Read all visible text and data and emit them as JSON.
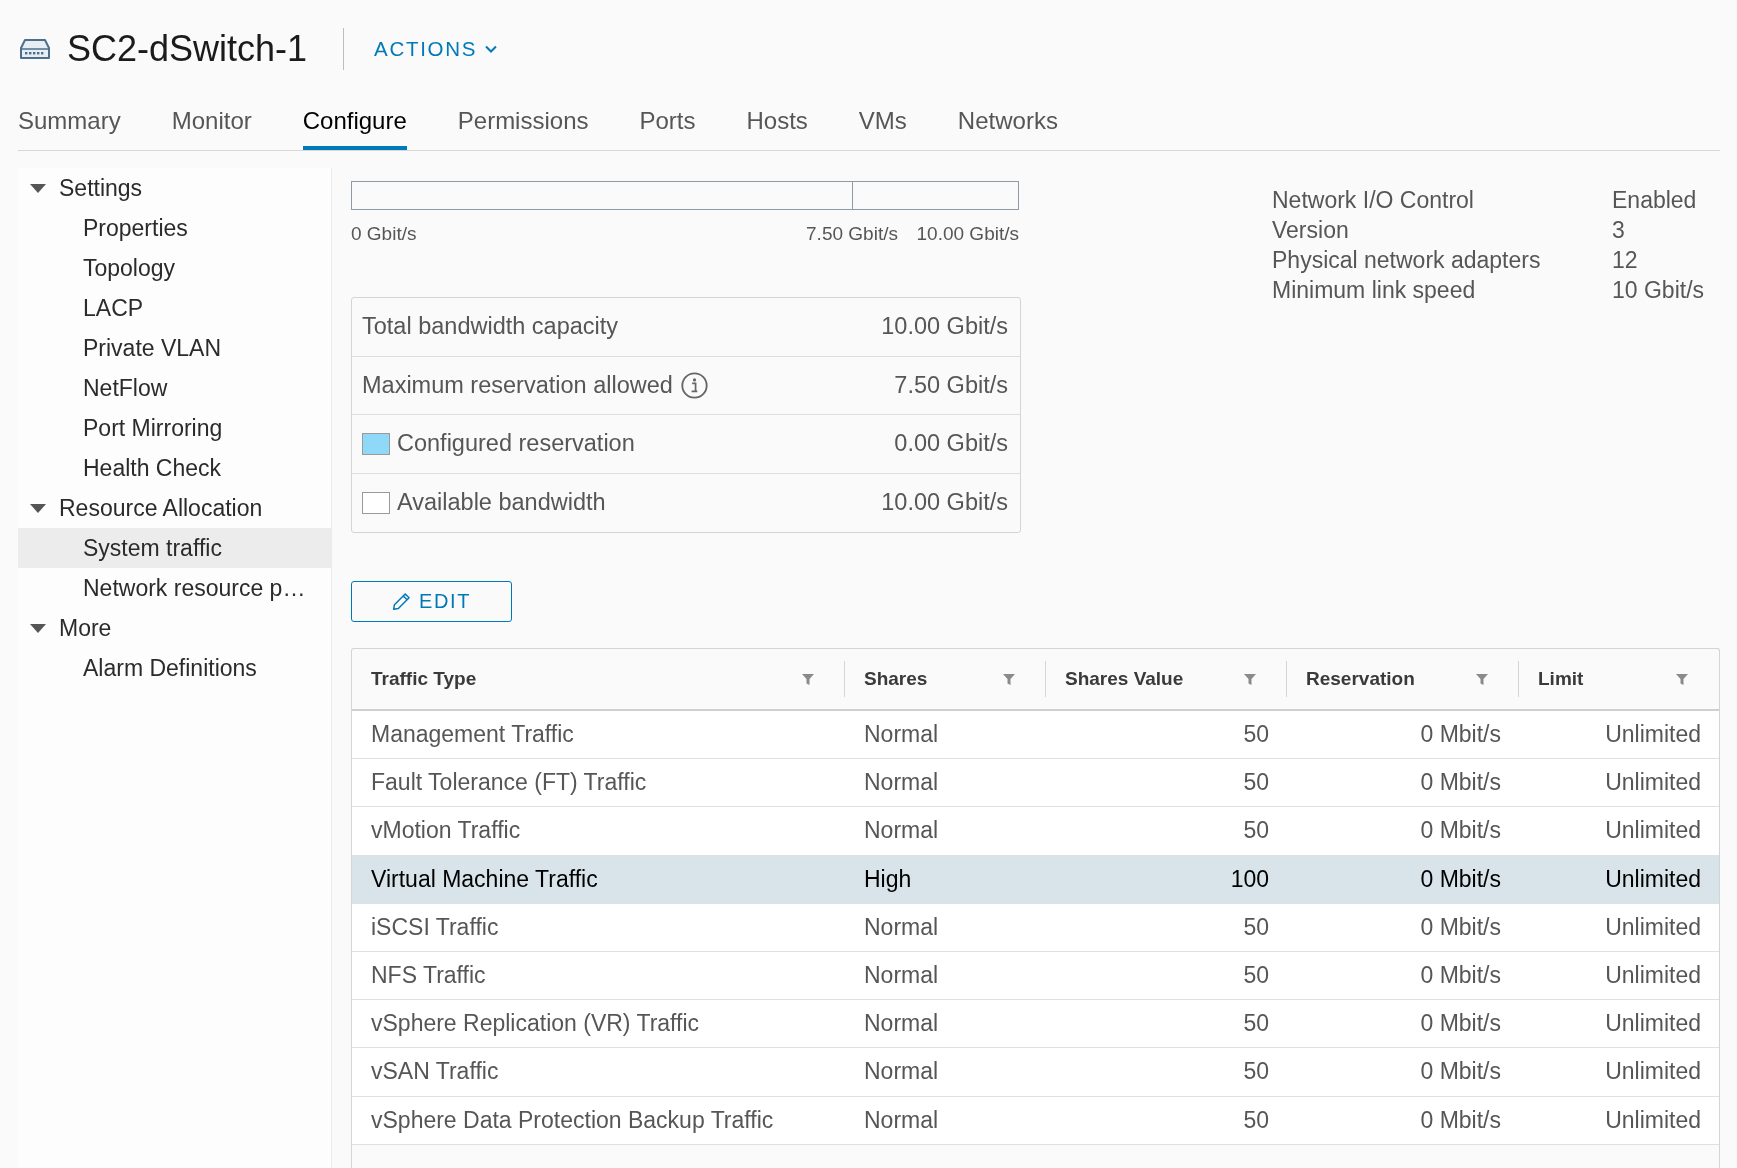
{
  "header": {
    "title": "SC2-dSwitch-1",
    "actions_label": "ACTIONS"
  },
  "tabs": [
    {
      "label": "Summary",
      "selected": false
    },
    {
      "label": "Monitor",
      "selected": false
    },
    {
      "label": "Configure",
      "selected": true
    },
    {
      "label": "Permissions",
      "selected": false
    },
    {
      "label": "Ports",
      "selected": false
    },
    {
      "label": "Hosts",
      "selected": false
    },
    {
      "label": "VMs",
      "selected": false
    },
    {
      "label": "Networks",
      "selected": false
    }
  ],
  "sidebar": {
    "groups": [
      {
        "label": "Settings",
        "expanded": true,
        "children": [
          {
            "label": "Properties",
            "selected": false
          },
          {
            "label": "Topology",
            "selected": false
          },
          {
            "label": "LACP",
            "selected": false
          },
          {
            "label": "Private VLAN",
            "selected": false
          },
          {
            "label": "NetFlow",
            "selected": false
          },
          {
            "label": "Port Mirroring",
            "selected": false
          },
          {
            "label": "Health Check",
            "selected": false
          }
        ]
      },
      {
        "label": "Resource Allocation",
        "expanded": true,
        "children": [
          {
            "label": "System traffic",
            "selected": true
          },
          {
            "label": "Network resource p…",
            "selected": false
          }
        ]
      },
      {
        "label": "More",
        "expanded": true,
        "children": [
          {
            "label": "Alarm Definitions",
            "selected": false
          }
        ]
      }
    ]
  },
  "bandwidth_bar": {
    "level": 0,
    "marker": {
      "level": 0.75
    },
    "scale_labels": [
      "0 Gbit/s",
      "7.50 Gbit/s",
      "10.00 Gbit/s"
    ]
  },
  "bandwidth_summary": [
    {
      "kind": "plain",
      "label": "Total bandwidth capacity",
      "value": "10.00 Gbit/s"
    },
    {
      "kind": "info",
      "label": "Maximum reservation allowed",
      "value": "7.50 Gbit/s"
    },
    {
      "kind": "legend",
      "color": "#8fd8f8",
      "label": "Configured reservation",
      "value": "0.00 Gbit/s"
    },
    {
      "kind": "legend",
      "color": "#ffffff",
      "label": "Available bandwidth",
      "value": "10.00 Gbit/s"
    }
  ],
  "edit_button": {
    "label": "EDIT"
  },
  "nioc_info": [
    {
      "label": "Network I/O Control",
      "value": "Enabled"
    },
    {
      "label": "Version",
      "value": "3"
    },
    {
      "label": "Physical network adapters",
      "value": "12"
    },
    {
      "label": "Minimum link speed",
      "value": "10 Gbit/s"
    }
  ],
  "table": {
    "columns": [
      {
        "label": "Traffic Type",
        "kind": "text"
      },
      {
        "label": "Shares",
        "kind": "text"
      },
      {
        "label": "Shares Value",
        "kind": "number"
      },
      {
        "label": "Reservation",
        "kind": "number"
      },
      {
        "label": "Limit",
        "kind": "number"
      }
    ],
    "rows": [
      {
        "selected": false,
        "cells": [
          "Management Traffic",
          "Normal",
          "50",
          "0 Mbit/s",
          "Unlimited"
        ]
      },
      {
        "selected": false,
        "cells": [
          "Fault Tolerance (FT) Traffic",
          "Normal",
          "50",
          "0 Mbit/s",
          "Unlimited"
        ]
      },
      {
        "selected": false,
        "cells": [
          "vMotion Traffic",
          "Normal",
          "50",
          "0 Mbit/s",
          "Unlimited"
        ]
      },
      {
        "selected": true,
        "cells": [
          "Virtual Machine Traffic",
          "High",
          "100",
          "0 Mbit/s",
          "Unlimited"
        ]
      },
      {
        "selected": false,
        "cells": [
          "iSCSI Traffic",
          "Normal",
          "50",
          "0 Mbit/s",
          "Unlimited"
        ]
      },
      {
        "selected": false,
        "cells": [
          "NFS Traffic",
          "Normal",
          "50",
          "0 Mbit/s",
          "Unlimited"
        ]
      },
      {
        "selected": false,
        "cells": [
          "vSphere Replication (VR) Traffic",
          "Normal",
          "50",
          "0 Mbit/s",
          "Unlimited"
        ]
      },
      {
        "selected": false,
        "cells": [
          "vSAN Traffic",
          "Normal",
          "50",
          "0 Mbit/s",
          "Unlimited"
        ]
      },
      {
        "selected": false,
        "cells": [
          "vSphere Data Protection Backup Traffic",
          "Normal",
          "50",
          "0 Mbit/s",
          "Unlimited"
        ]
      }
    ]
  }
}
